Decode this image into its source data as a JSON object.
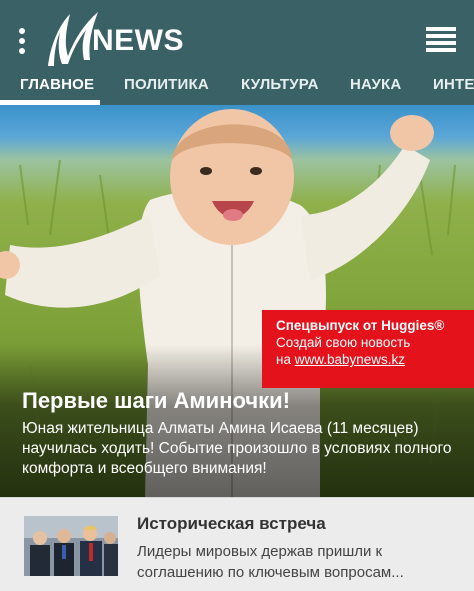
{
  "app": {
    "logo_text": "NEWS"
  },
  "nav": {
    "tabs": [
      {
        "label": "ГЛАВНОЕ",
        "active": true
      },
      {
        "label": "ПОЛИТИКА",
        "active": false
      },
      {
        "label": "КУЛЬТУРА",
        "active": false
      },
      {
        "label": "НАУКА",
        "active": false
      },
      {
        "label": "ИНТЕ",
        "active": false
      }
    ]
  },
  "hero": {
    "promo": {
      "title": "Спецвыпуск от Huggies®",
      "line1": "Создай свою новость",
      "line2_prefix": "на ",
      "link": "www.babynews.kz",
      "color": "#e3121b"
    },
    "title": "Первые шаги Аминочки!",
    "text": "Юная жительница Алматы Амина Исаева (11 месяцев) научилась ходить! Событие произошло в условиях полного комфорта и всеобщего внимания!"
  },
  "card": {
    "title": "Историческая встреча",
    "text": "Лидеры мировых держав пришли к соглашению по ключевым вопросам..."
  },
  "colors": {
    "header": "#3a6166",
    "accent": "#e3121b"
  },
  "icons": {
    "menu_left": "kebab-icon",
    "menu_right": "hamburger-icon"
  }
}
